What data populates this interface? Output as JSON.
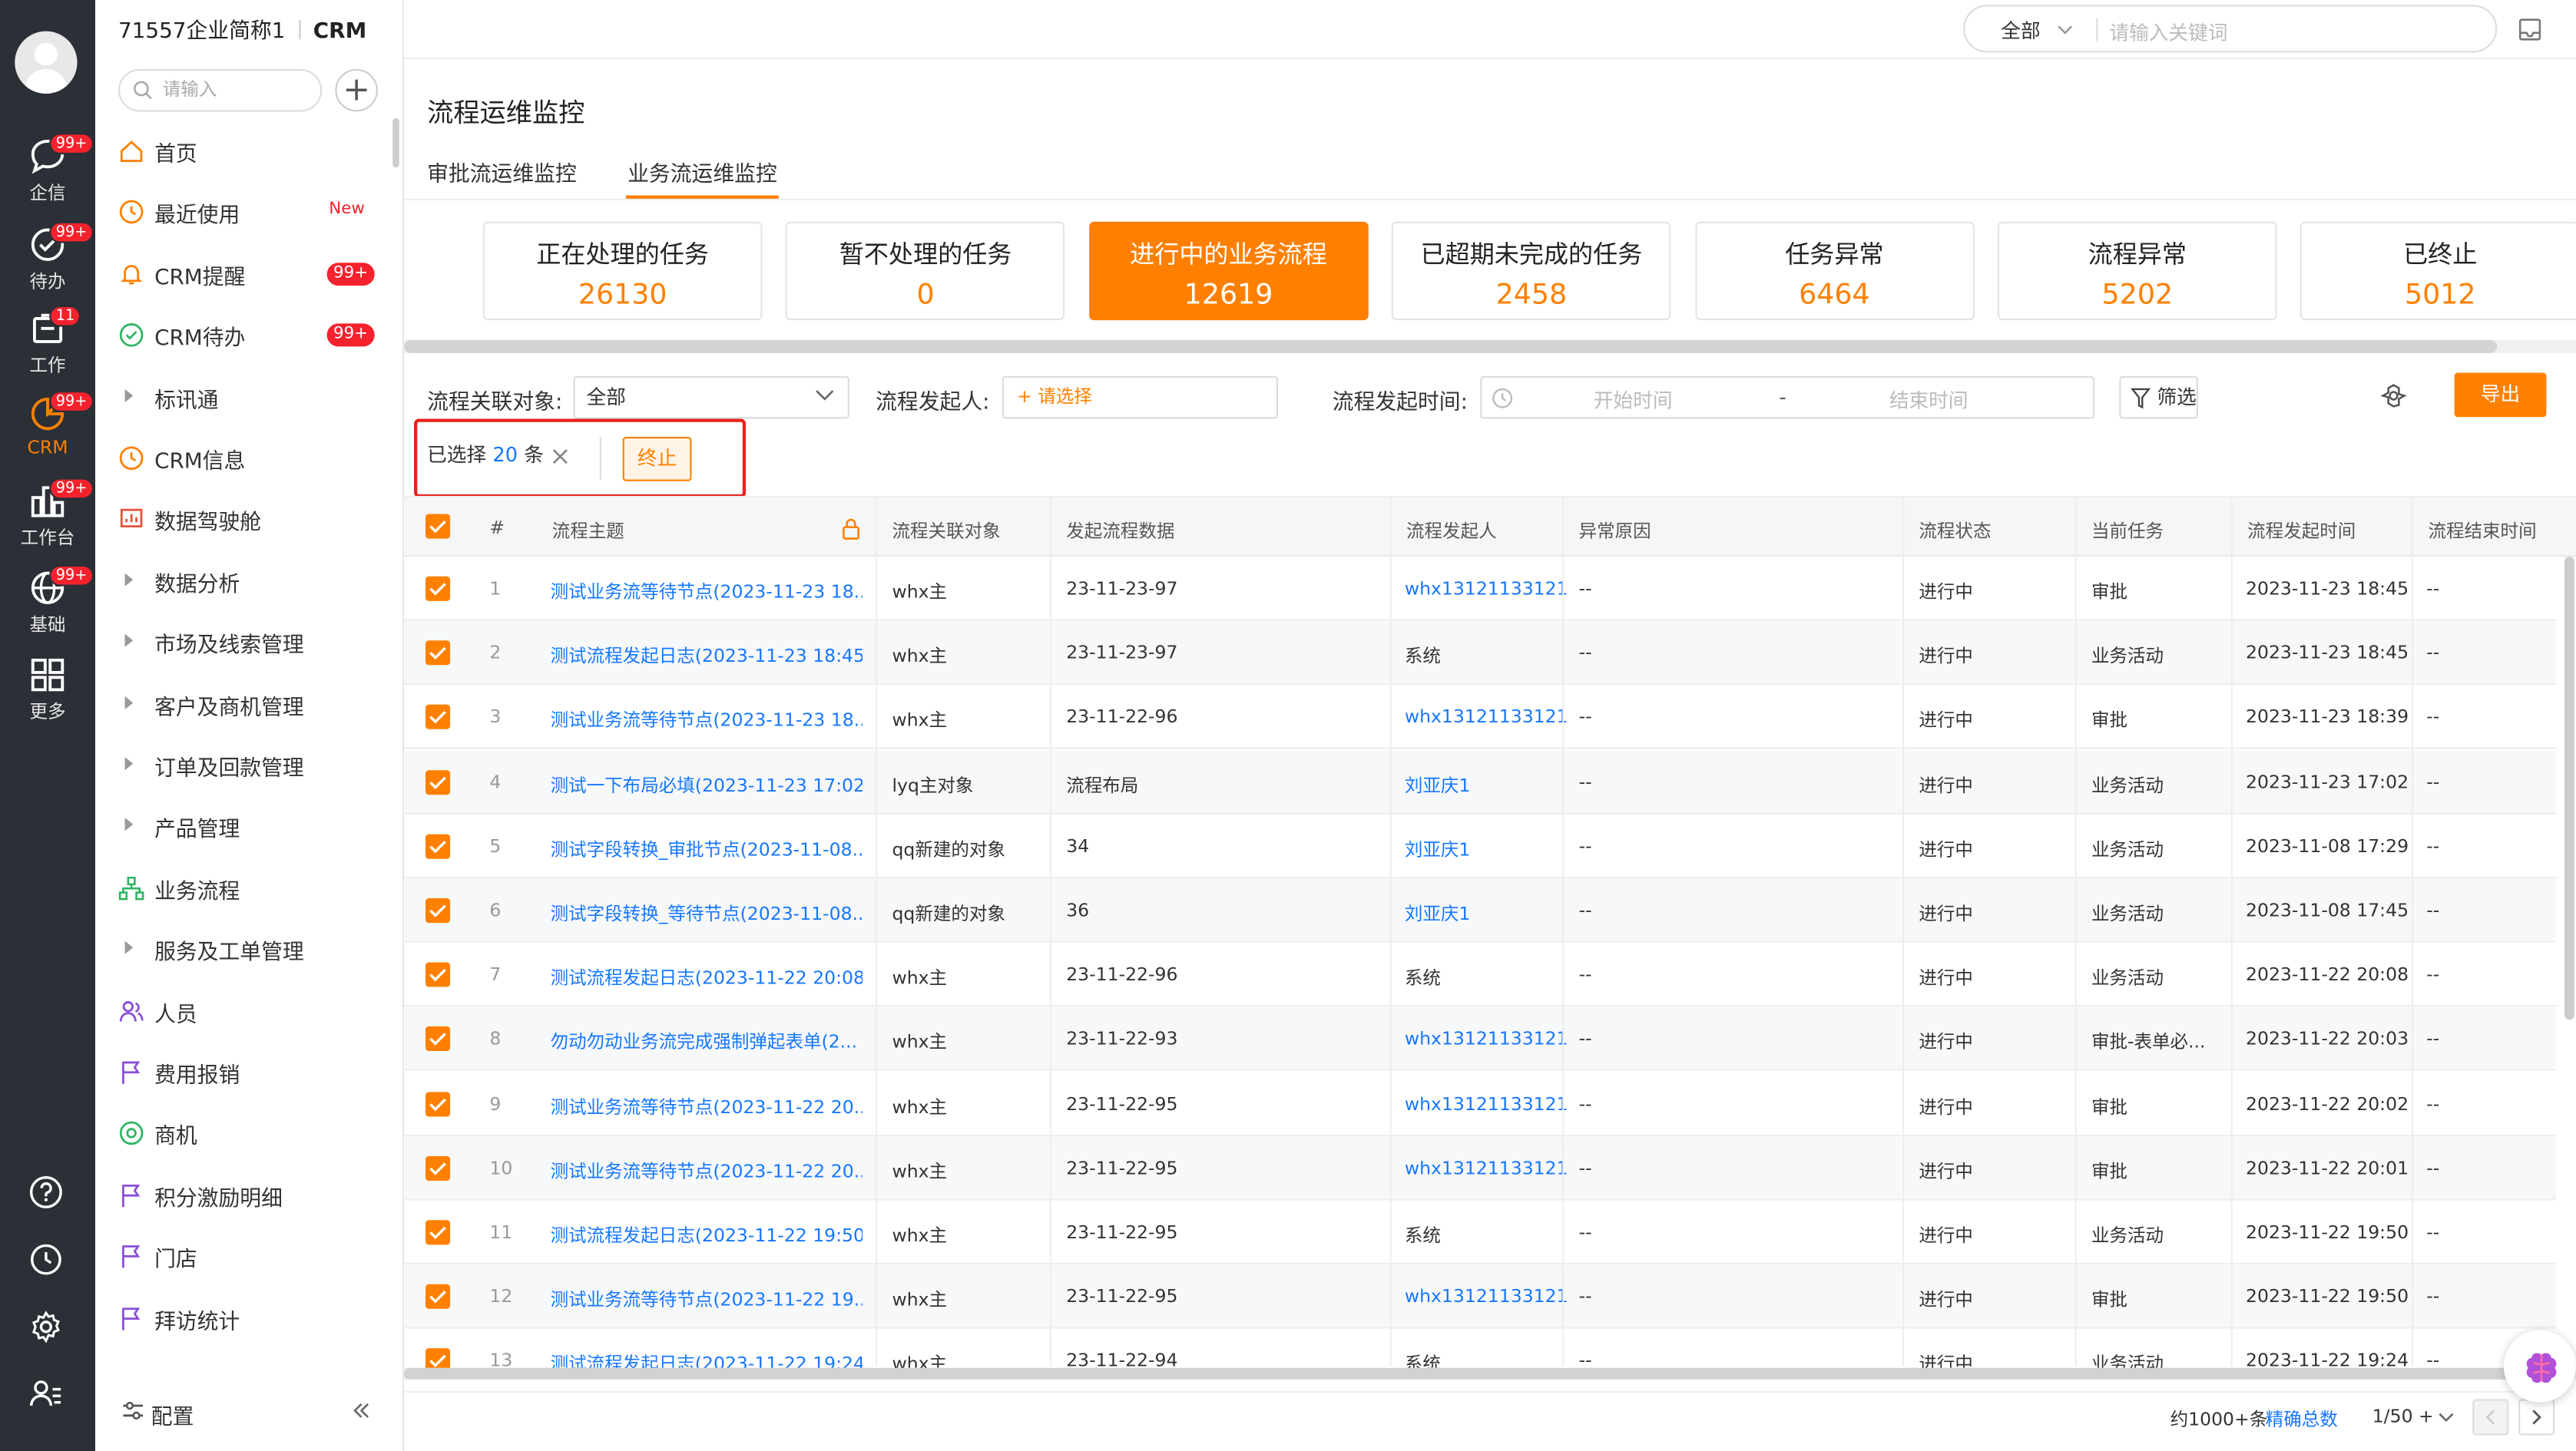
{
  "brand": {
    "company": "71557企业简称1",
    "app": "CRM"
  },
  "global_search": {
    "scope": "全部",
    "placeholder": "请输入关键词"
  },
  "rail": {
    "items": [
      {
        "label": "企信",
        "badge": "99+",
        "icon": "chat-icon"
      },
      {
        "label": "待办",
        "badge": "99+",
        "icon": "check-circle-icon"
      },
      {
        "label": "工作",
        "badge": "11",
        "icon": "briefcase-icon"
      },
      {
        "label": "CRM",
        "badge": "99+",
        "icon": "pie-chart-icon"
      },
      {
        "label": "工作台",
        "badge": "99+",
        "icon": "dashboard-icon"
      },
      {
        "label": "基础",
        "badge": "99+",
        "icon": "globe-icon"
      },
      {
        "label": "更多",
        "badge": "",
        "icon": "grid-icon"
      }
    ]
  },
  "nav": {
    "search_placeholder": "请输入",
    "items": [
      {
        "label": "首页",
        "icon": "home-icon"
      },
      {
        "label": "最近使用",
        "icon": "clock-icon",
        "tag": "New"
      },
      {
        "label": "CRM提醒",
        "icon": "bell-icon",
        "badge": "99+"
      },
      {
        "label": "CRM待办",
        "icon": "check-circle-icon",
        "badge": "99+"
      },
      {
        "label": "标讯通",
        "caret": true
      },
      {
        "label": "CRM信息",
        "icon": "clock-icon"
      },
      {
        "label": "数据驾驶舱",
        "icon": "chart-icon"
      },
      {
        "label": "数据分析",
        "caret": true
      },
      {
        "label": "市场及线索管理",
        "caret": true
      },
      {
        "label": "客户及商机管理",
        "caret": true
      },
      {
        "label": "订单及回款管理",
        "caret": true
      },
      {
        "label": "产品管理",
        "caret": true
      },
      {
        "label": "业务流程",
        "icon": "flow-icon"
      },
      {
        "label": "服务及工单管理",
        "caret": true
      },
      {
        "label": "人员",
        "icon": "people-icon"
      },
      {
        "label": "费用报销",
        "icon": "flag-icon"
      },
      {
        "label": "商机",
        "icon": "target-icon"
      },
      {
        "label": "积分激励明细",
        "icon": "flag-icon"
      },
      {
        "label": "门店",
        "icon": "flag-icon"
      },
      {
        "label": "拜访统计",
        "icon": "flag-icon"
      }
    ],
    "footer_label": "配置"
  },
  "page": {
    "title": "流程运维监控",
    "tabs": [
      "审批流运维监控",
      "业务流运维监控"
    ],
    "stats": [
      {
        "label": "正在处理的任务",
        "value": "26130"
      },
      {
        "label": "暂不处理的任务",
        "value": "0"
      },
      {
        "label": "进行中的业务流程",
        "value": "12619"
      },
      {
        "label": "已超期未完成的任务",
        "value": "2458"
      },
      {
        "label": "任务异常",
        "value": "6464"
      },
      {
        "label": "流程异常",
        "value": "5202"
      },
      {
        "label": "已终止",
        "value": "5012"
      }
    ],
    "filters": {
      "object_label": "流程关联对象:",
      "object_value": "全部",
      "initiator_label": "流程发起人:",
      "initiator_placeholder": "+ 请选择",
      "time_label": "流程发起时间:",
      "start_placeholder": "开始时间",
      "dash": "-",
      "end_placeholder": "结束时间",
      "filter_button": "筛选",
      "export_button": "导出"
    },
    "selection": {
      "prefix": "已选择",
      "count": "20",
      "suffix": "条",
      "terminate": "终止"
    }
  },
  "table": {
    "headers": [
      "#",
      "流程主题",
      "流程关联对象",
      "发起流程数据",
      "流程发起人",
      "异常原因",
      "流程状态",
      "当前任务",
      "流程发起时间",
      "流程结束时间"
    ],
    "rows": [
      [
        "1",
        "测试业务流等待节点(2023-11-23 18...",
        "whx主",
        "23-11-23-97",
        "whx13121133121",
        "--",
        "进行中",
        "审批",
        "2023-11-23 18:45",
        "--"
      ],
      [
        "2",
        "测试流程发起日志(2023-11-23 18:45)",
        "whx主",
        "23-11-23-97",
        "系统",
        "--",
        "进行中",
        "业务活动",
        "2023-11-23 18:45",
        "--"
      ],
      [
        "3",
        "测试业务流等待节点(2023-11-23 18...",
        "whx主",
        "23-11-22-96",
        "whx13121133121",
        "--",
        "进行中",
        "审批",
        "2023-11-23 18:39",
        "--"
      ],
      [
        "4",
        "测试一下布局必填(2023-11-23 17:02)",
        "lyq主对象",
        "流程布局",
        "刘亚庆1",
        "--",
        "进行中",
        "业务活动",
        "2023-11-23 17:02",
        "--"
      ],
      [
        "5",
        "测试字段转换_审批节点(2023-11-08...",
        "qq新建的对象",
        "34",
        "刘亚庆1",
        "--",
        "进行中",
        "业务活动",
        "2023-11-08 17:29",
        "--"
      ],
      [
        "6",
        "测试字段转换_等待节点(2023-11-08...",
        "qq新建的对象",
        "36",
        "刘亚庆1",
        "--",
        "进行中",
        "业务活动",
        "2023-11-08 17:45",
        "--"
      ],
      [
        "7",
        "测试流程发起日志(2023-11-22 20:08)",
        "whx主",
        "23-11-22-96",
        "系统",
        "--",
        "进行中",
        "业务活动",
        "2023-11-22 20:08",
        "--"
      ],
      [
        "8",
        "勿动勿动业务流完成强制弹起表单(2...",
        "whx主",
        "23-11-22-93",
        "whx13121133121",
        "--",
        "进行中",
        "审批-表单必...",
        "2023-11-22 20:03",
        "--"
      ],
      [
        "9",
        "测试业务流等待节点(2023-11-22 20...",
        "whx主",
        "23-11-22-95",
        "whx13121133121",
        "--",
        "进行中",
        "审批",
        "2023-11-22 20:02",
        "--"
      ],
      [
        "10",
        "测试业务流等待节点(2023-11-22 20...",
        "whx主",
        "23-11-22-95",
        "whx13121133121",
        "--",
        "进行中",
        "审批",
        "2023-11-22 20:01",
        "--"
      ],
      [
        "11",
        "测试流程发起日志(2023-11-22 19:50)",
        "whx主",
        "23-11-22-95",
        "系统",
        "--",
        "进行中",
        "业务活动",
        "2023-11-22 19:50",
        "--"
      ],
      [
        "12",
        "测试业务流等待节点(2023-11-22 19...",
        "whx主",
        "23-11-22-95",
        "whx13121133121",
        "--",
        "进行中",
        "审批",
        "2023-11-22 19:50",
        "--"
      ],
      [
        "13",
        "测试流程发起日志(2023-11-22 19:24)",
        "whx主",
        "23-11-22-94",
        "系统",
        "--",
        "进行中",
        "业务活动",
        "2023-11-22 19:24",
        "--"
      ]
    ],
    "footer": {
      "total": "约1000+条",
      "exact": "精确总数",
      "page": "1/50 +"
    }
  }
}
